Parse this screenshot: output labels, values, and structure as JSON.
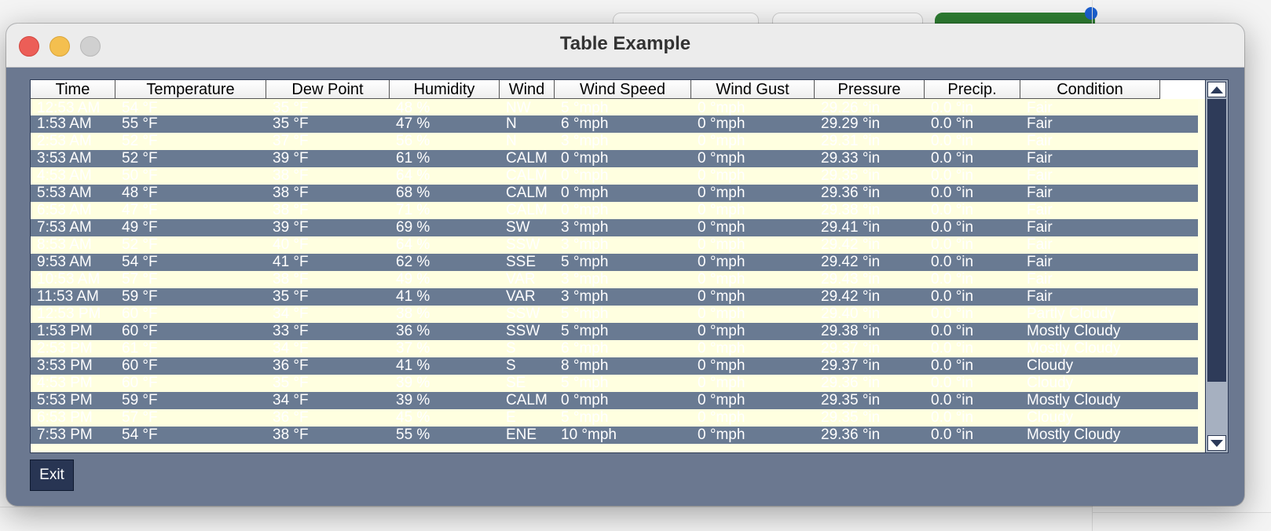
{
  "window": {
    "title": "Table Example"
  },
  "table": {
    "columns": [
      "Time",
      "Temperature",
      "Dew Point",
      "Humidity",
      "Wind",
      "Wind Speed",
      "Wind Gust",
      "Pressure",
      "Precip.",
      "Condition"
    ],
    "rows": [
      [
        "12:53 AM",
        "54 °F",
        "35 °F",
        "48 %",
        "NW",
        "5 °mph",
        "0 °mph",
        "29.26 °in",
        "0.0 °in",
        "Fair"
      ],
      [
        "1:53 AM",
        "55 °F",
        "35 °F",
        "47 %",
        "N",
        "6 °mph",
        "0 °mph",
        "29.29 °in",
        "0.0 °in",
        "Fair"
      ],
      [
        "2:53 AM",
        "52 °F",
        "37 °F",
        "56 %",
        "N",
        "3 °mph",
        "0 °mph",
        "29.31 °in",
        "0.0 °in",
        "Fair"
      ],
      [
        "3:53 AM",
        "52 °F",
        "39 °F",
        "61 %",
        "CALM",
        "0 °mph",
        "0 °mph",
        "29.33 °in",
        "0.0 °in",
        "Fair"
      ],
      [
        "4:53 AM",
        "50 °F",
        "38 °F",
        "64 %",
        "CALM",
        "0 °mph",
        "0 °mph",
        "29.35 °in",
        "0.0 °in",
        "Fair"
      ],
      [
        "5:53 AM",
        "48 °F",
        "38 °F",
        "68 %",
        "CALM",
        "0 °mph",
        "0 °mph",
        "29.36 °in",
        "0.0 °in",
        "Fair"
      ],
      [
        "6:53 AM",
        "47 °F",
        "38 °F",
        "71 %",
        "CALM",
        "0 °mph",
        "0 °mph",
        "29.38 °in",
        "0.0 °in",
        "Fair"
      ],
      [
        "7:53 AM",
        "49 °F",
        "39 °F",
        "69 %",
        "SW",
        "3 °mph",
        "0 °mph",
        "29.41 °in",
        "0.0 °in",
        "Fair"
      ],
      [
        "8:53 AM",
        "52 °F",
        "40 °F",
        "64 %",
        "SSW",
        "3 °mph",
        "0 °mph",
        "29.42 °in",
        "0.0 °in",
        "Fair"
      ],
      [
        "9:53 AM",
        "54 °F",
        "41 °F",
        "62 %",
        "SSE",
        "5 °mph",
        "0 °mph",
        "29.42 °in",
        "0.0 °in",
        "Fair"
      ],
      [
        "10:53 AM",
        "57 °F",
        "38 °F",
        "49 %",
        "VAR",
        "3 °mph",
        "0 °mph",
        "29.43 °in",
        "0.0 °in",
        "Fair"
      ],
      [
        "11:53 AM",
        "59 °F",
        "35 °F",
        "41 %",
        "VAR",
        "3 °mph",
        "0 °mph",
        "29.42 °in",
        "0.0 °in",
        "Fair"
      ],
      [
        "12:53 PM",
        "60 °F",
        "34 °F",
        "38 %",
        "SSW",
        "5 °mph",
        "0 °mph",
        "29.40 °in",
        "0.0 °in",
        "Partly Cloudy"
      ],
      [
        "1:53 PM",
        "60 °F",
        "33 °F",
        "36 %",
        "SSW",
        "5 °mph",
        "0 °mph",
        "29.38 °in",
        "0.0 °in",
        "Mostly Cloudy"
      ],
      [
        "2:53 PM",
        "61 °F",
        "34 °F",
        "37 %",
        "S",
        "6 °mph",
        "0 °mph",
        "29.37 °in",
        "0.0 °in",
        "Mostly Cloudy"
      ],
      [
        "3:53 PM",
        "60 °F",
        "36 °F",
        "41 %",
        "S",
        "8 °mph",
        "0 °mph",
        "29.37 °in",
        "0.0 °in",
        "Cloudy"
      ],
      [
        "4:53 PM",
        "60 °F",
        "35 °F",
        "39 %",
        "SE",
        "5 °mph",
        "0 °mph",
        "29.36 °in",
        "0.0 °in",
        "Cloudy"
      ],
      [
        "5:53 PM",
        "59 °F",
        "34 °F",
        "39 %",
        "CALM",
        "0 °mph",
        "0 °mph",
        "29.35 °in",
        "0.0 °in",
        "Mostly Cloudy"
      ],
      [
        "6:53 PM",
        "57 °F",
        "36 °F",
        "45 %",
        "E",
        "5 °mph",
        "0 °mph",
        "29.35 °in",
        "0.0 °in",
        "Cloudy"
      ],
      [
        "7:53 PM",
        "54 °F",
        "38 °F",
        "55 %",
        "ENE",
        "10 °mph",
        "0 °mph",
        "29.36 °in",
        "0.0 °in",
        "Mostly Cloudy"
      ]
    ]
  },
  "buttons": {
    "exit_label": "Exit"
  },
  "colors": {
    "row_light": "#ffffe0",
    "row_dark": "#697a92",
    "window_bg": "#6b7890"
  }
}
